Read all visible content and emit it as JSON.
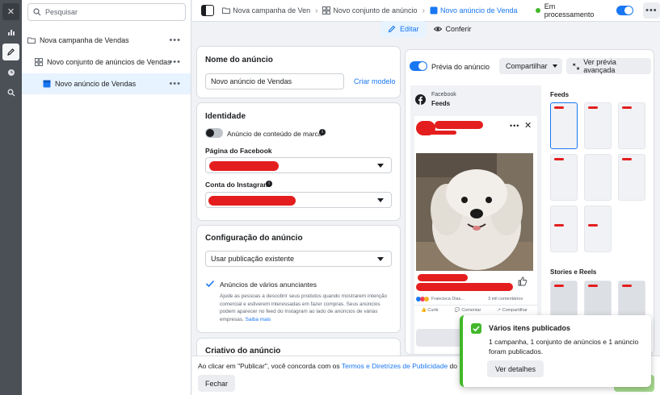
{
  "tree": {
    "search_placeholder": "Pesquisar",
    "campaign": "Nova campanha de Vendas",
    "adset": "Novo conjunto de anúncios de Vendas",
    "ad": "Novo anúncio de Vendas",
    "more": "•••"
  },
  "topbar": {
    "crumb_campaign": "Nova campanha de Vendas",
    "crumb_adset": "Novo conjunto de anúncios",
    "crumb_ad": "Novo anúncio de Vendas",
    "status": "Em processamento",
    "more": "•••"
  },
  "tabs": {
    "edit": "Editar",
    "review": "Conferir"
  },
  "ad_name": {
    "title": "Nome do anúncio",
    "value": "Novo anúncio de Vendas",
    "create_template": "Criar modelo"
  },
  "identity": {
    "title": "Identidade",
    "branded_content": "Anúncio de conteúdo de marca",
    "facebook_page_label": "Página do Facebook",
    "instagram_label": "Conta do Instagram"
  },
  "ad_setup": {
    "title": "Configuração do anúncio",
    "select_value": "Usar publicação existente",
    "multi_advertiser_label": "Anúncios de vários anunciantes",
    "multi_advertiser_desc": "Ajude as pessoas a descobrir seus produtos quando mostrarem intenção comercial e estiverem interessadas em fazer compras. Seus anúncios podem aparecer no feed do Instagram ao lado de anúncios de várias empresas.",
    "learn_more": "Saiba mais"
  },
  "creative": {
    "title": "Criativo do anúncio"
  },
  "preview": {
    "toggle_label": "Prévia do anúncio",
    "share": "Compartilhar",
    "advanced": "Ver prévia avançada",
    "platform": "Facebook",
    "placement": "Feeds",
    "reactions_name": "Francisca Dias...",
    "comments": "3 mil comentários",
    "like": "Curtir",
    "comment": "Comentar",
    "share_action": "Compartilhar",
    "feeds_heading": "Feeds",
    "stories_heading": "Stories e Reels"
  },
  "toast": {
    "title": "Vários itens publicados",
    "body": "1 campanha, 1 conjunto de anúncios e 1 anúncio foram publicados.",
    "button": "Ver detalhes"
  },
  "footer": {
    "prefix": "Ao clicar em \"Publicar\", você concorda com os ",
    "terms_link": "Termos e Diretrizes de Publicidade",
    "suffix": " do Face",
    "close": "Fechar"
  },
  "colors": {
    "accent": "#1877f2",
    "success": "#42b72a",
    "redaction": "#e41e1e"
  }
}
